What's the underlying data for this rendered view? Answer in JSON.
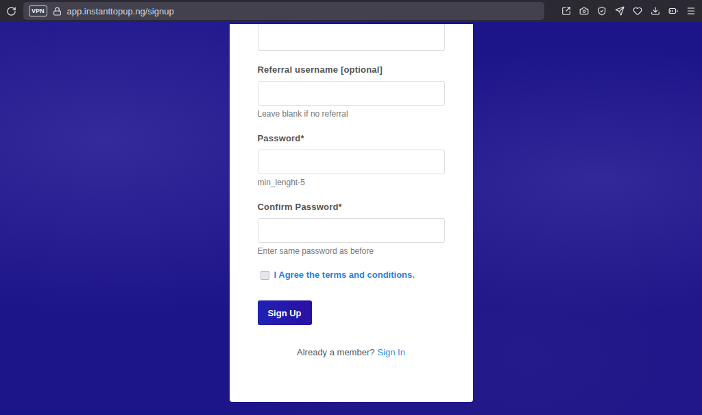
{
  "browser": {
    "vpn": "VPN",
    "url": "app.instanttopup.ng/signup"
  },
  "form": {
    "fields": [
      {
        "label": "",
        "hint": "",
        "value": "",
        "cut_off": true
      },
      {
        "label": "Referral username [optional]",
        "hint": "Leave blank if no referral",
        "value": "",
        "cut_off": false
      },
      {
        "label": "Password*",
        "hint": "min_lenght-5",
        "value": "",
        "cut_off": false
      },
      {
        "label": "Confirm Password*",
        "hint": "Enter same password as before",
        "value": "",
        "cut_off": false
      }
    ],
    "terms": {
      "label": "I Agree the terms and conditions.",
      "checked": false
    },
    "submit": "Sign Up",
    "footer": {
      "text": "Already a member?",
      "link": "Sign In"
    }
  }
}
